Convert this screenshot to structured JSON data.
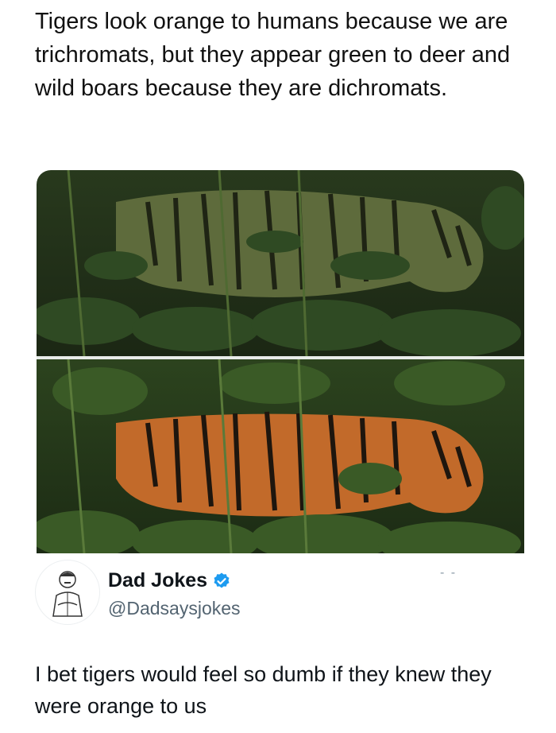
{
  "caption": "Tigers look orange to humans because we are trichromats, but they appear green to deer and wild boars because they are dichromats.",
  "images": {
    "top_colors": {
      "tiger": "#5e6b3c",
      "stripe": "#1f2414",
      "foliage": "#2f4a23"
    },
    "bottom_colors": {
      "tiger": "#c26a2a",
      "stripe": "#1e160e",
      "foliage": "#3a5a26"
    }
  },
  "tweet": {
    "display_name": "Dad Jokes",
    "handle": "@Dadsaysjokes",
    "more_menu": "- -",
    "text": "I bet tigers would feel so dumb if they knew they were orange to us",
    "verified_color": "#1d9bf0"
  }
}
